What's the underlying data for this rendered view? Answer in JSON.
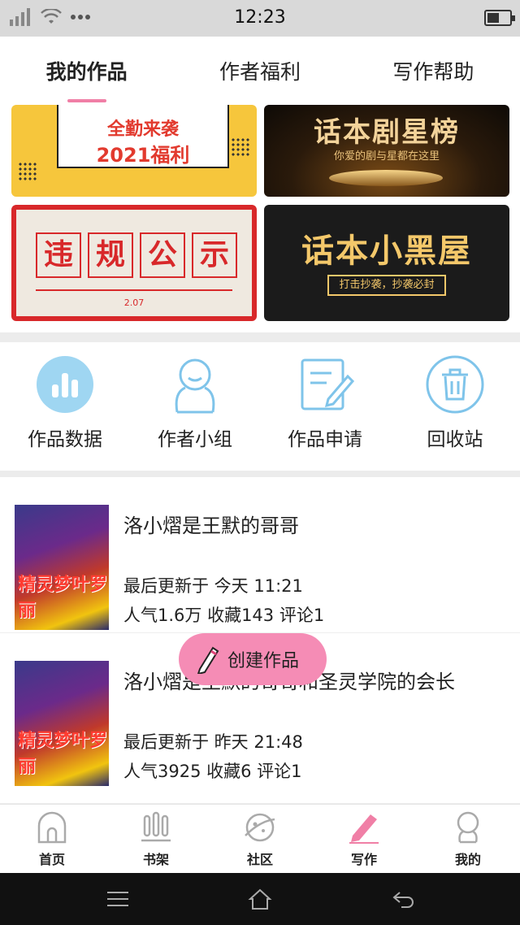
{
  "status_bar": {
    "time": "12:23"
  },
  "tabs": [
    {
      "label": "我的作品",
      "active": true
    },
    {
      "label": "作者福利",
      "active": false
    },
    {
      "label": "写作帮助",
      "active": false
    }
  ],
  "banners": {
    "welfare": {
      "line1": "全勤来袭",
      "line2": "2021福利"
    },
    "star_ranking": {
      "title": "话本剧星榜",
      "subtitle": "你爱的剧与星都在这里"
    },
    "violation": {
      "chars": [
        "违",
        "规",
        "公",
        "示"
      ],
      "date": "2.07"
    },
    "blacklist": {
      "title": "话本小黑屋",
      "subtitle": "打击抄袭，抄袭必封"
    }
  },
  "tools": [
    {
      "label": "作品数据",
      "icon": "bar-chart-icon"
    },
    {
      "label": "作者小组",
      "icon": "group-icon"
    },
    {
      "label": "作品申请",
      "icon": "edit-document-icon"
    },
    {
      "label": "回收站",
      "icon": "trash-icon"
    }
  ],
  "works": [
    {
      "title": "洛小熠是王默的哥哥",
      "updated": "最后更新于 今天 11:21",
      "stats": "人气1.6万 收藏143 评论1",
      "cover_text": "精灵梦叶罗丽"
    },
    {
      "title": "洛小熠是王默的哥哥和圣灵学院的会长",
      "updated": "最后更新于 昨天 21:48",
      "stats": "人气3925 收藏6 评论1",
      "cover_text": "精灵梦叶罗丽"
    }
  ],
  "create_button": {
    "label": "创建作品"
  },
  "bottom_nav": [
    {
      "label": "首页",
      "icon": "home-icon",
      "active": false
    },
    {
      "label": "书架",
      "icon": "bookshelf-icon",
      "active": false
    },
    {
      "label": "社区",
      "icon": "planet-icon",
      "active": false
    },
    {
      "label": "写作",
      "icon": "pen-icon",
      "active": true
    },
    {
      "label": "我的",
      "icon": "profile-icon",
      "active": false
    }
  ],
  "colors": {
    "accent": "#f07fa6",
    "icon_blue": "#7fc4ea",
    "create_button": "#f58cb5"
  }
}
